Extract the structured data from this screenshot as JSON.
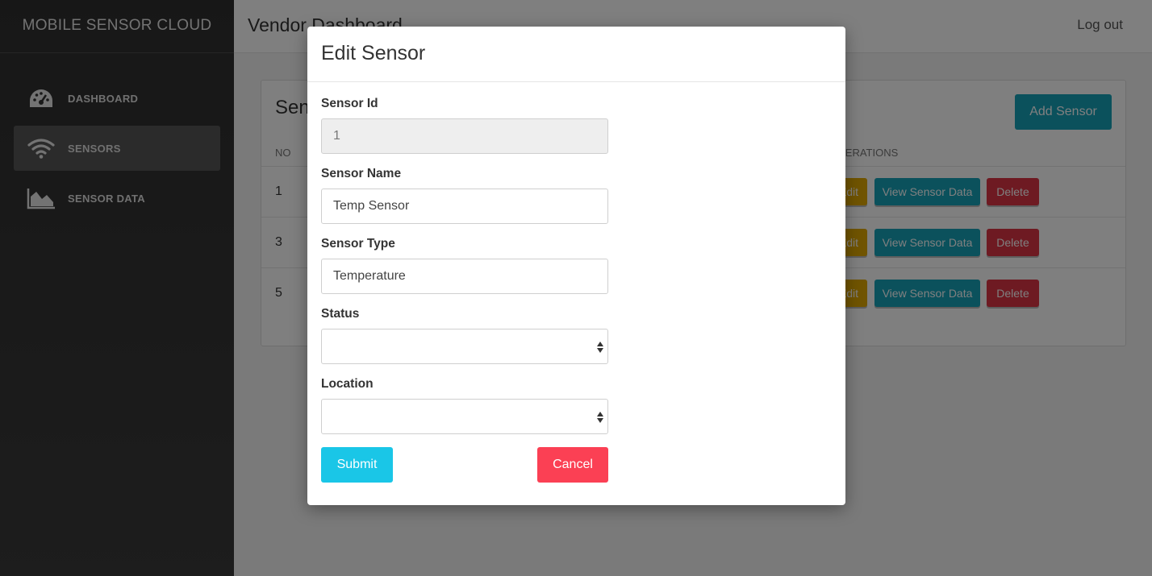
{
  "sidebar": {
    "brand": "MOBILE SENSOR CLOUD",
    "items": [
      {
        "label": "DASHBOARD",
        "icon": "dashboard-gauge-icon",
        "active": false
      },
      {
        "label": "SENSORS",
        "icon": "wifi-icon",
        "active": true
      },
      {
        "label": "SENSOR DATA",
        "icon": "area-chart-icon",
        "active": false
      }
    ]
  },
  "topbar": {
    "title": "Vendor Dashboard",
    "logout_label": "Log out"
  },
  "card": {
    "title": "Sensors",
    "add_label": "Add Sensor",
    "columns": {
      "no": "NO",
      "operations": "OPERATIONS"
    },
    "rows": [
      {
        "no": "1",
        "edit": "Edit",
        "view": "View Sensor Data",
        "delete": "Delete"
      },
      {
        "no": "3",
        "edit": "Edit",
        "view": "View Sensor Data",
        "delete": "Delete"
      },
      {
        "no": "5",
        "edit": "Edit",
        "view": "View Sensor Data",
        "delete": "Delete"
      }
    ]
  },
  "modal": {
    "title": "Edit Sensor",
    "fields": {
      "sensor_id": {
        "label": "Sensor Id",
        "value": "1"
      },
      "sensor_name": {
        "label": "Sensor Name",
        "value": "Temp Sensor"
      },
      "sensor_type": {
        "label": "Sensor Type",
        "value": "Temperature"
      },
      "status": {
        "label": "Status",
        "value": ""
      },
      "location": {
        "label": "Location",
        "value": ""
      }
    },
    "submit_label": "Submit",
    "cancel_label": "Cancel"
  },
  "colors": {
    "sidebar_bg": "#333333",
    "primary": "#17a2b8",
    "submit": "#1ac6e7",
    "cancel": "#fb4054",
    "warning": "#e0a800",
    "danger": "#dc3545"
  }
}
